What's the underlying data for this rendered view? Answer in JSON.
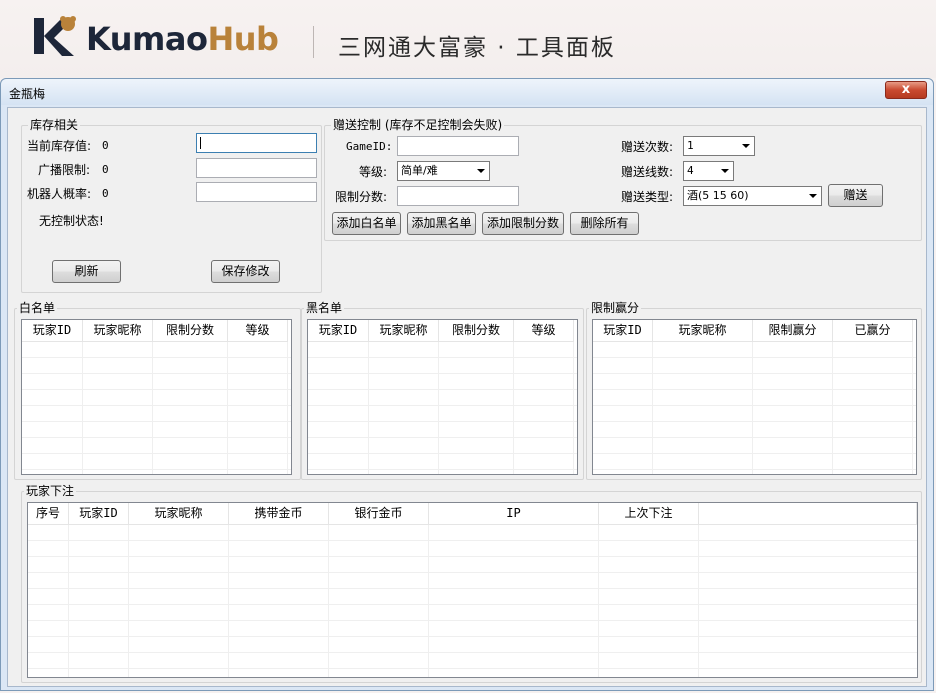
{
  "banner": {
    "logo_kumao": "Kumao",
    "logo_hub": "Hub",
    "title": "三网通大富豪 · 工具面板",
    "colors": {
      "navy": "#1d2639",
      "gold": "#b9823a"
    }
  },
  "window": {
    "title": "金瓶梅",
    "close_label": "x"
  },
  "inventory": {
    "title": "库存相关",
    "current_label": "当前库存值:",
    "current_value": "0",
    "broadcast_label": "广播限制:",
    "broadcast_value": "0",
    "robot_label": "机器人概率:",
    "robot_value": "0",
    "status_text": "无控制状态!",
    "refresh_label": "刷新",
    "save_label": "保存修改"
  },
  "gift": {
    "title": "赠送控制 (库存不足控制会失败)",
    "gameid_label": "GameID:",
    "level_label": "等级:",
    "level_value": "简单/难",
    "limit_label": "限制分数:",
    "count_label": "赠送次数:",
    "count_value": "1",
    "lines_label": "赠送线数:",
    "lines_value": "4",
    "type_label": "赠送类型:",
    "type_value": "酒(5 15 60)",
    "send_label": "赠送",
    "add_white_label": "添加白名单",
    "add_black_label": "添加黑名单",
    "add_limit_label": "添加限制分数",
    "delete_all_label": "删除所有"
  },
  "whitelist": {
    "title": "白名单",
    "columns": [
      "玩家ID",
      "玩家昵称",
      "限制分数",
      "等级"
    ]
  },
  "blacklist": {
    "title": "黑名单",
    "columns": [
      "玩家ID",
      "玩家昵称",
      "限制分数",
      "等级"
    ]
  },
  "limitwin": {
    "title": "限制赢分",
    "columns": [
      "玩家ID",
      "玩家昵称",
      "限制赢分",
      "已赢分"
    ]
  },
  "bets": {
    "title": "玩家下注",
    "columns": [
      "序号",
      "玩家ID",
      "玩家昵称",
      "携带金币",
      "银行金币",
      "IP",
      "上次下注"
    ]
  }
}
